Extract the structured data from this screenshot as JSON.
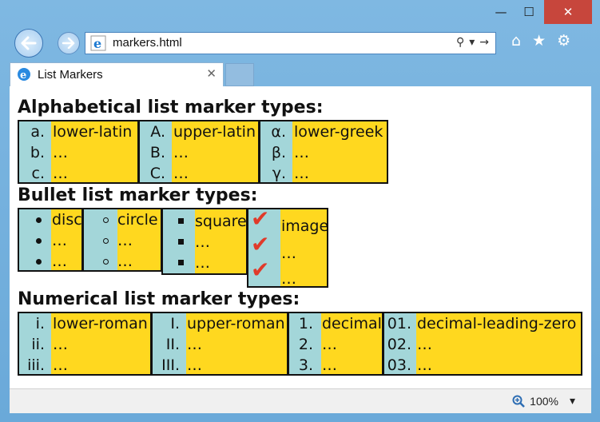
{
  "window": {
    "minimize_glyph": "—",
    "maximize_glyph": "☐",
    "close_glyph": "✕"
  },
  "toolbar": {
    "address_url": "markers.html",
    "search_glyph": "⚲",
    "dropdown_glyph": "▾",
    "go_glyph": "→",
    "home_glyph": "⌂",
    "favorites_glyph": "★",
    "settings_glyph": "⚙"
  },
  "tab": {
    "title": "List Markers",
    "close_glyph": "✕"
  },
  "page": {
    "alpha_heading": "Alphabetical list marker types:",
    "bullet_heading": "Bullet list marker types:",
    "numeric_heading": "Numerical list marker types:",
    "alpha_lists": [
      {
        "markers": [
          "a.",
          "b.",
          "c."
        ],
        "items": [
          "lower-latin",
          "…",
          "…"
        ]
      },
      {
        "markers": [
          "A.",
          "B.",
          "C."
        ],
        "items": [
          "upper-latin",
          "…",
          "…"
        ]
      },
      {
        "markers": [
          "α.",
          "β.",
          "γ."
        ],
        "items": [
          "lower-greek",
          "…",
          "…"
        ]
      }
    ],
    "bullet_lists": [
      {
        "marker_type": "disc",
        "items": [
          "disc",
          "…",
          "…"
        ]
      },
      {
        "marker_type": "circle",
        "items": [
          "circle",
          "…",
          "…"
        ]
      },
      {
        "marker_type": "square",
        "items": [
          "square",
          "…",
          "…"
        ]
      },
      {
        "marker_type": "image",
        "items": [
          "image",
          "…",
          "…"
        ]
      }
    ],
    "numeric_lists": [
      {
        "markers": [
          "i.",
          "ii.",
          "iii."
        ],
        "items": [
          "lower-roman",
          "…",
          "…"
        ]
      },
      {
        "markers": [
          "I.",
          "II.",
          "III."
        ],
        "items": [
          "upper-roman",
          "…",
          "…"
        ]
      },
      {
        "markers": [
          "1.",
          "2.",
          "3."
        ],
        "items": [
          "decimal",
          "…",
          "…"
        ]
      },
      {
        "markers": [
          "01.",
          "02.",
          "03."
        ],
        "items": [
          "decimal-leading-zero",
          "…",
          "…"
        ]
      }
    ]
  },
  "statusbar": {
    "zoom": "100%",
    "zoom_dropdown": "▾"
  },
  "colors": {
    "list_background": "#ffd81f",
    "marker_gutter": "#a3d6d9",
    "checkmark": "#e03a2a",
    "window_frame": "#7ab4df",
    "close_button": "#c7463c"
  }
}
